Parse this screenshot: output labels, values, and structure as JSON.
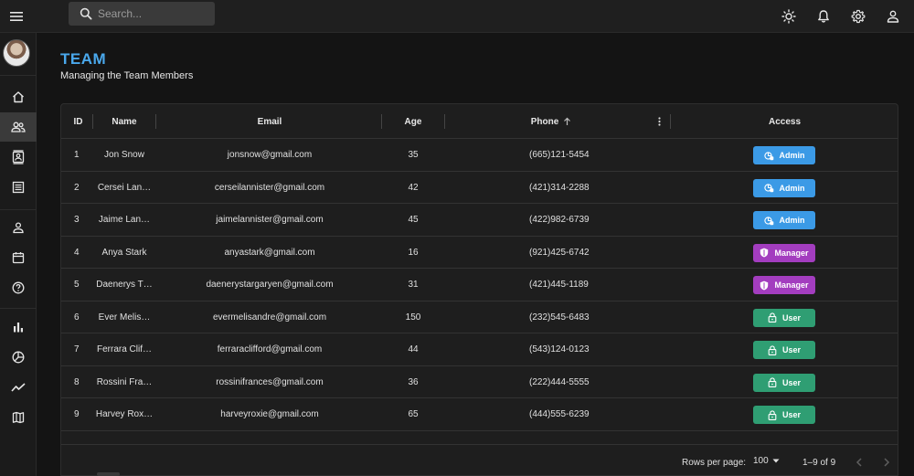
{
  "search": {
    "placeholder": "Search..."
  },
  "header": {
    "title": "TEAM",
    "subtitle": "Managing the Team Members"
  },
  "columns": {
    "id": "ID",
    "name": "Name",
    "email": "Email",
    "age": "Age",
    "phone": "Phone",
    "access": "Access"
  },
  "rows": [
    {
      "id": "1",
      "name": "Jon Snow",
      "email": "jonsnow@gmail.com",
      "age": "35",
      "phone": "(665)121-5454",
      "access": "Admin"
    },
    {
      "id": "2",
      "name": "Cersei Lan…",
      "email": "cerseilannister@gmail.com",
      "age": "42",
      "phone": "(421)314-2288",
      "access": "Admin"
    },
    {
      "id": "3",
      "name": "Jaime Lan…",
      "email": "jaimelannister@gmail.com",
      "age": "45",
      "phone": "(422)982-6739",
      "access": "Admin"
    },
    {
      "id": "4",
      "name": "Anya Stark",
      "email": "anyastark@gmail.com",
      "age": "16",
      "phone": "(921)425-6742",
      "access": "Manager"
    },
    {
      "id": "5",
      "name": "Daenerys T…",
      "email": "daenerystargaryen@gmail.com",
      "age": "31",
      "phone": "(421)445-1189",
      "access": "Manager"
    },
    {
      "id": "6",
      "name": "Ever Melis…",
      "email": "evermelisandre@gmail.com",
      "age": "150",
      "phone": "(232)545-6483",
      "access": "User"
    },
    {
      "id": "7",
      "name": "Ferrara Clif…",
      "email": "ferraraclifford@gmail.com",
      "age": "44",
      "phone": "(543)124-0123",
      "access": "User"
    },
    {
      "id": "8",
      "name": "Rossini Fra…",
      "email": "rossinifrances@gmail.com",
      "age": "36",
      "phone": "(222)444-5555",
      "access": "User"
    },
    {
      "id": "9",
      "name": "Harvey Rox…",
      "email": "harveyroxie@gmail.com",
      "age": "65",
      "phone": "(444)555-6239",
      "access": "User"
    }
  ],
  "footer": {
    "rows_per_page_label": "Rows per page:",
    "rows_per_page_value": "100",
    "range": "1–9 of 9"
  },
  "colors": {
    "accent": "#4aa8ec",
    "admin": "#3b9ae6",
    "manager": "#a33dbf",
    "user": "#2f9e73"
  }
}
